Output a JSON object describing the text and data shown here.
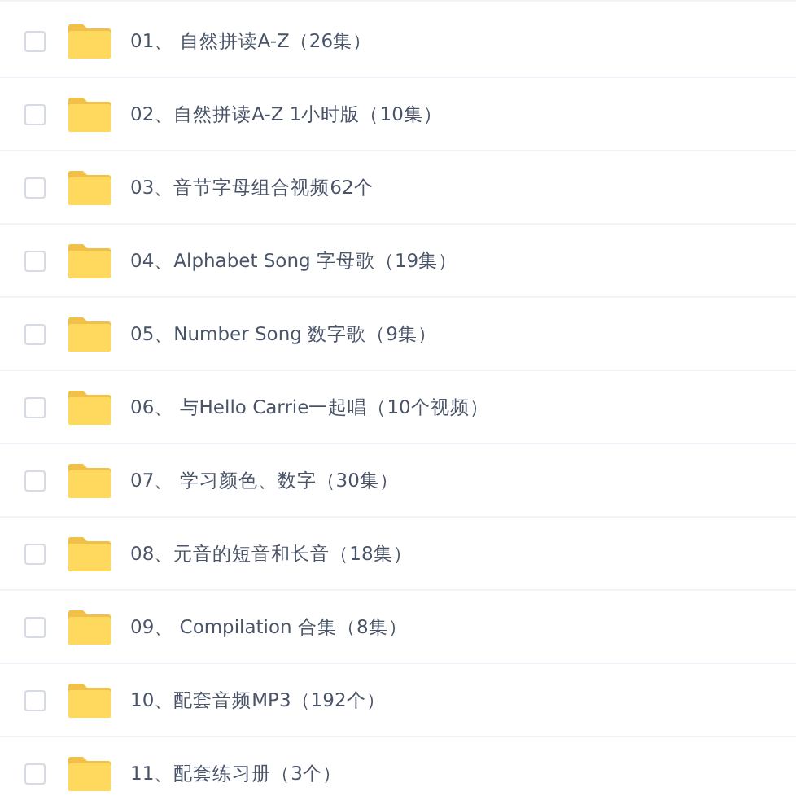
{
  "folders": [
    {
      "name": "01、 自然拼读A-Z（26集）",
      "checked": false
    },
    {
      "name": "02、自然拼读A-Z 1小时版（10集）",
      "checked": false
    },
    {
      "name": "03、音节字母组合视频62个",
      "checked": false
    },
    {
      "name": "04、Alphabet Song 字母歌（19集）",
      "checked": false
    },
    {
      "name": "05、Number Song 数字歌（9集）",
      "checked": false
    },
    {
      "name": "06、 与Hello Carrie一起唱（10个视频）",
      "checked": false
    },
    {
      "name": "07、 学习颜色、数字（30集）",
      "checked": false
    },
    {
      "name": "08、元音的短音和长音（18集）",
      "checked": false
    },
    {
      "name": "09、 Compilation 合集（8集）",
      "checked": false
    },
    {
      "name": "10、配套音频MP3（192个）",
      "checked": false
    },
    {
      "name": "11、配套练习册（3个）",
      "checked": false
    }
  ]
}
